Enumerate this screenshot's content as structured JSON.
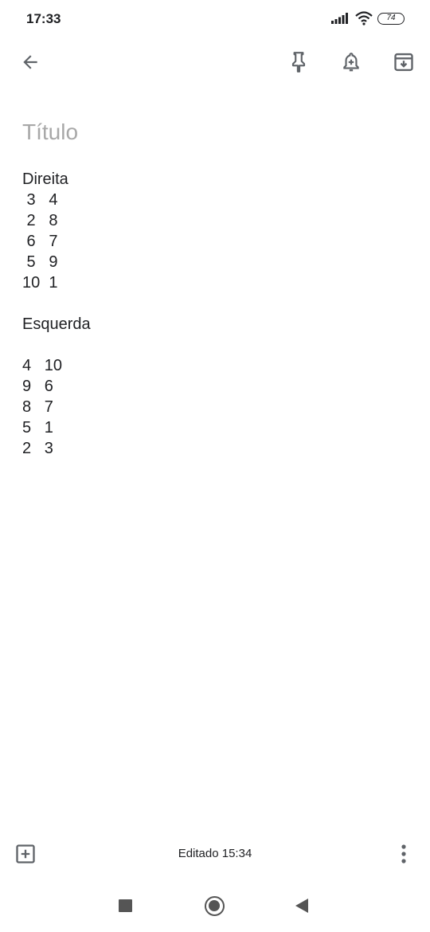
{
  "status_bar": {
    "time": "17:33",
    "battery_level": "74",
    "icons": [
      "signal-icon",
      "wifi-icon",
      "battery-icon"
    ]
  },
  "toolbar": {
    "icons": [
      "back-arrow-icon",
      "pin-icon",
      "reminder-bell-icon",
      "archive-icon"
    ]
  },
  "note": {
    "title_placeholder": "Título",
    "body": "Direita\n 3   4\n 2   8\n 6   7\n 5   9\n10  1\n\nEsquerda\n\n4   10\n9   6\n8   7\n5   1\n2   3"
  },
  "bottom_bar": {
    "edited_label": "Editado 15:34",
    "icons": [
      "add-box-icon",
      "more-vert-icon"
    ]
  },
  "nav_bar": {
    "icons": [
      "recents-square-icon",
      "home-circle-icon",
      "back-triangle-icon"
    ]
  },
  "colors": {
    "text": "#202124",
    "placeholder": "#a8a8a8",
    "icon": "#5f6368",
    "nav": "#555555"
  }
}
